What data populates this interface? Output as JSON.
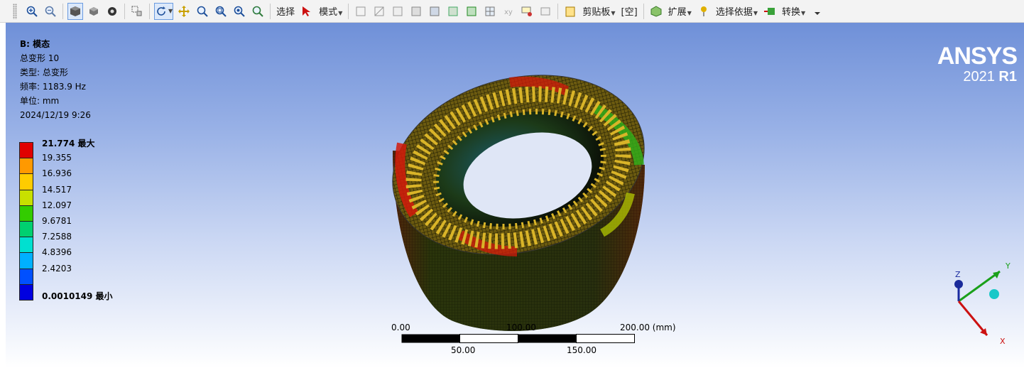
{
  "toolbar": {
    "select_label": "选择",
    "mode_label": "模式",
    "clipboard_label": "剪贴板",
    "empty_label": "[空]",
    "expand_label": "扩展",
    "select_basis_label": "选择依据",
    "convert_label": "转换"
  },
  "info": {
    "title": "B: 模态",
    "line1": "总变形 10",
    "line2": "类型: 总变形",
    "line3": "频率: 1183.9   Hz",
    "line4": "单位: mm",
    "line5": "2024/12/19 9:26"
  },
  "legend": {
    "labels": [
      "21.774 最大",
      "19.355",
      "16.936",
      "14.517",
      "12.097",
      "9.6781",
      "7.2588",
      "4.8396",
      "2.4203",
      "0.0010149 最小"
    ],
    "colors": [
      "#e00000",
      "#ff9900",
      "#ffcc00",
      "#c8e000",
      "#33cc00",
      "#00d070",
      "#00e0d0",
      "#00b0ff",
      "#0050ff",
      "#0000e0"
    ]
  },
  "logo": {
    "brand": "ANSYS",
    "version": "2021",
    "release": "R1"
  },
  "scale": {
    "l0": "0.00",
    "l1": "100.00",
    "l2": "200.00 (mm)",
    "l3": "50.00",
    "l4": "150.00"
  },
  "axes": {
    "x": "X",
    "y": "Y",
    "z": "Z"
  },
  "colors": {
    "stator_dark": "#1f2a08",
    "stator_mesh": "#c9a020"
  }
}
